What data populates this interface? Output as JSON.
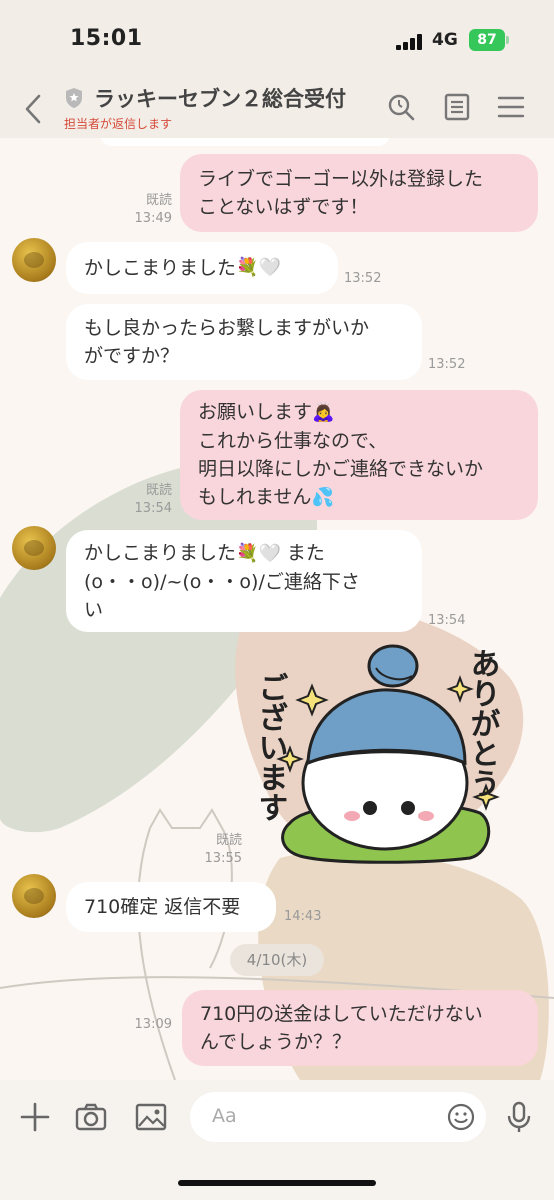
{
  "status_bar": {
    "time": "15:01",
    "network": "4G",
    "battery": "87"
  },
  "header": {
    "title": "ラッキーセブン２総合受付",
    "subtitle": "担当者が返信します"
  },
  "messages": [
    {
      "side": "out",
      "lines": [
        "ライブでゴーゴー以外は登録した",
        "ことないはずです！"
      ],
      "read": "既読",
      "time": "13:49"
    },
    {
      "side": "in",
      "lines": [
        "かしこまりました"
      ],
      "emoji": [
        "bouquet",
        "white-heart"
      ],
      "time": "13:52"
    },
    {
      "side": "in",
      "lines": [
        "もし良かったらお繋しますがいか",
        "がですか？"
      ],
      "time": "13:52"
    },
    {
      "side": "out",
      "lines": [
        "お願いします",
        "これから仕事なので、",
        "明日以降にしかご連絡できないか",
        "もしれません"
      ],
      "emoji": [
        "bowing-person",
        "sweat-droplets"
      ],
      "read": "既読",
      "time": "13:54"
    },
    {
      "side": "in",
      "lines": [
        "かしこまりました",
        " また",
        "(o・・o)/~(o・・o)/ご連絡下さ",
        "い"
      ],
      "emoji": [
        "bouquet",
        "white-heart"
      ],
      "time": "13:54"
    },
    {
      "side": "out",
      "type": "sticker",
      "sticker_text": [
        "ありがとう",
        "ございます"
      ],
      "read": "既読",
      "time": "13:55"
    },
    {
      "side": "in",
      "lines": [
        "710確定 返信不要"
      ],
      "time": "14:43"
    },
    {
      "side": "out",
      "lines": [
        "710円の送金はしていただけない",
        "んでしょうか？？"
      ],
      "time": "13:09"
    }
  ],
  "date_separator": "4/10(木)",
  "composer": {
    "placeholder": "Aa"
  },
  "colors": {
    "outgoing_bubble": "#f9d6dc",
    "incoming_bubble": "#ffffff",
    "subtitle_red": "#d44a3a",
    "battery_green": "#35c759"
  },
  "icons": [
    "back-chevron-icon",
    "shield-icon",
    "search-icon",
    "notes-icon",
    "menu-icon",
    "plus-icon",
    "camera-icon",
    "image-icon",
    "emoji-icon",
    "microphone-icon"
  ]
}
